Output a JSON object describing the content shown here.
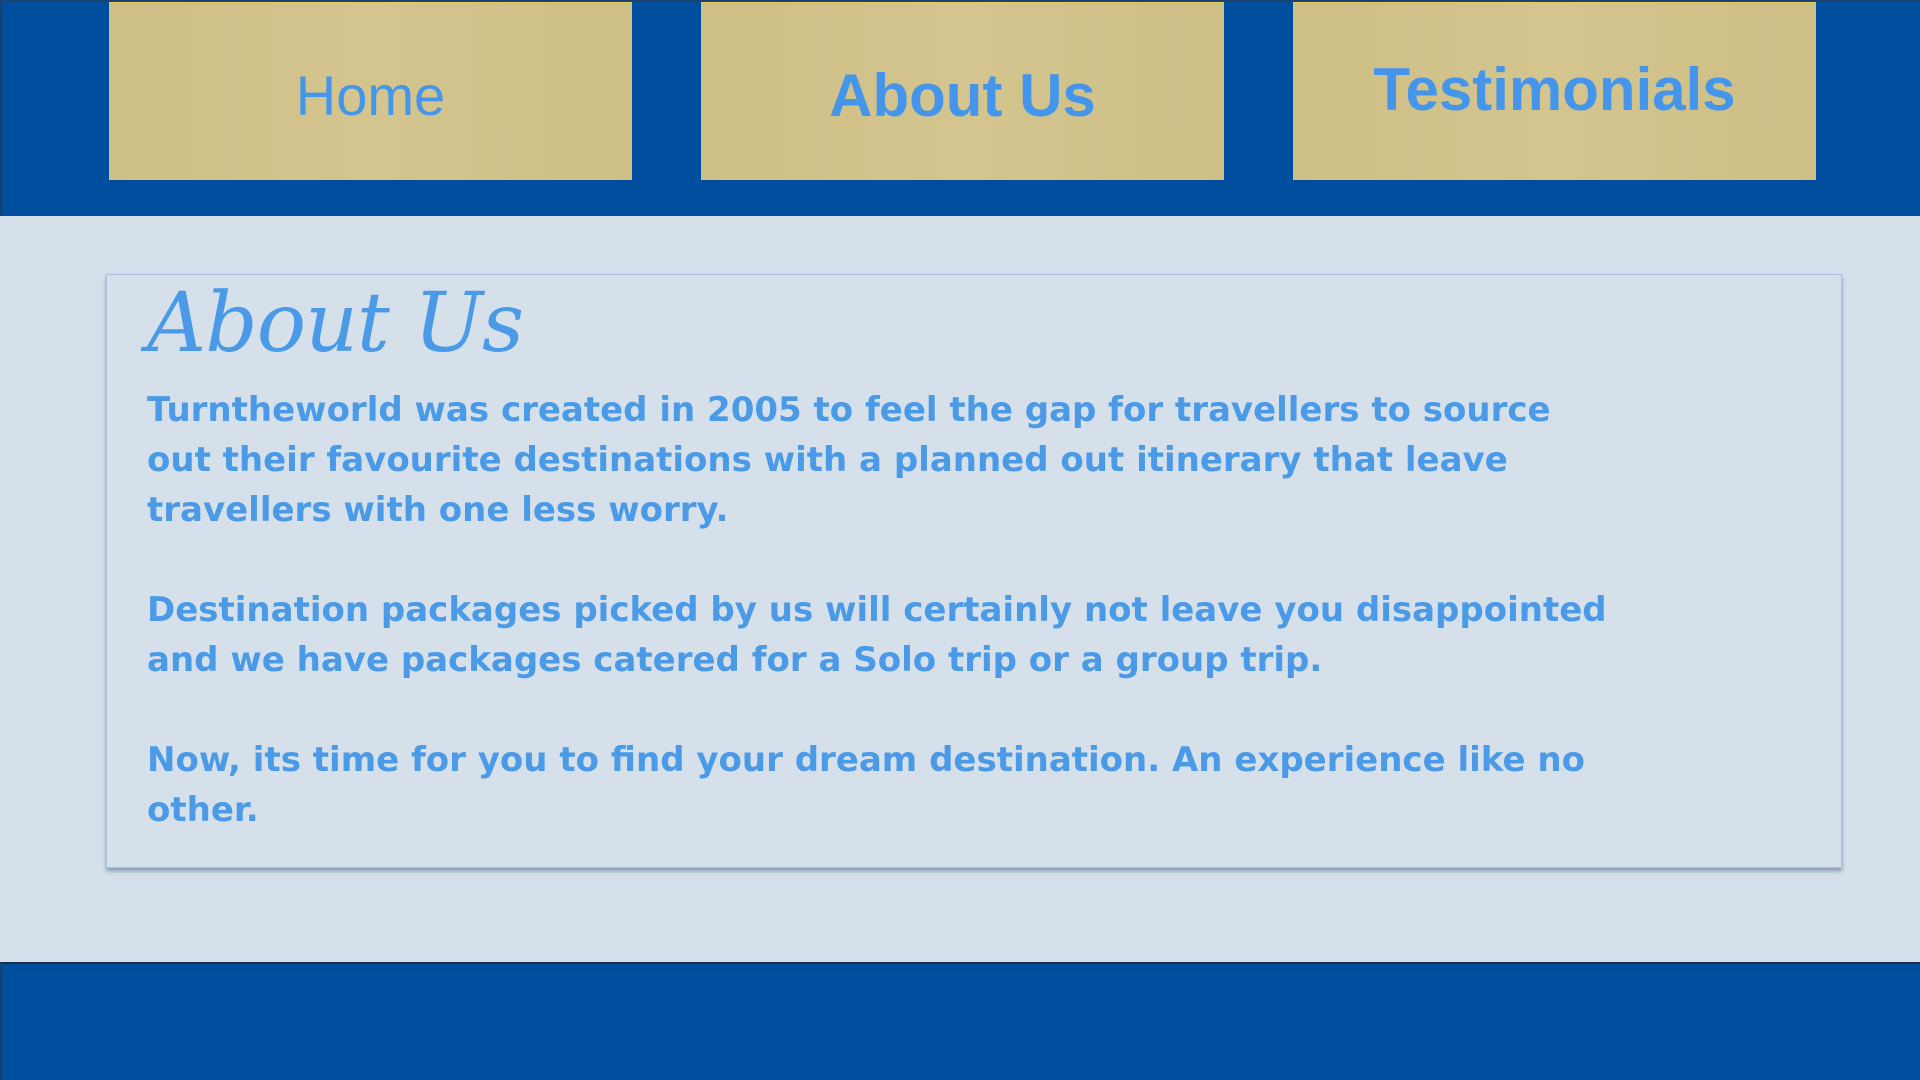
{
  "nav": {
    "home_label": "Home",
    "about_label": "About Us",
    "testimonials_label": "Testimonials"
  },
  "about": {
    "title": "About Us",
    "paragraphs": [
      "Turntheworld was created in 2005 to feel the gap for travellers to source out their favourite destinations with a planned out itinerary that leave travellers with one less worry.",
      "Destination packages picked by us will certainly not leave you disappointed and we have packages catered for a Solo trip or a group trip.",
      "Now, its time for you to find your dream destination. An experience like no other."
    ]
  },
  "colors": {
    "header_bg": "#004f9f",
    "nav_button_bg": "#cfc089",
    "accent_text": "#4a9ae8",
    "page_bg": "#d6e0ea"
  }
}
